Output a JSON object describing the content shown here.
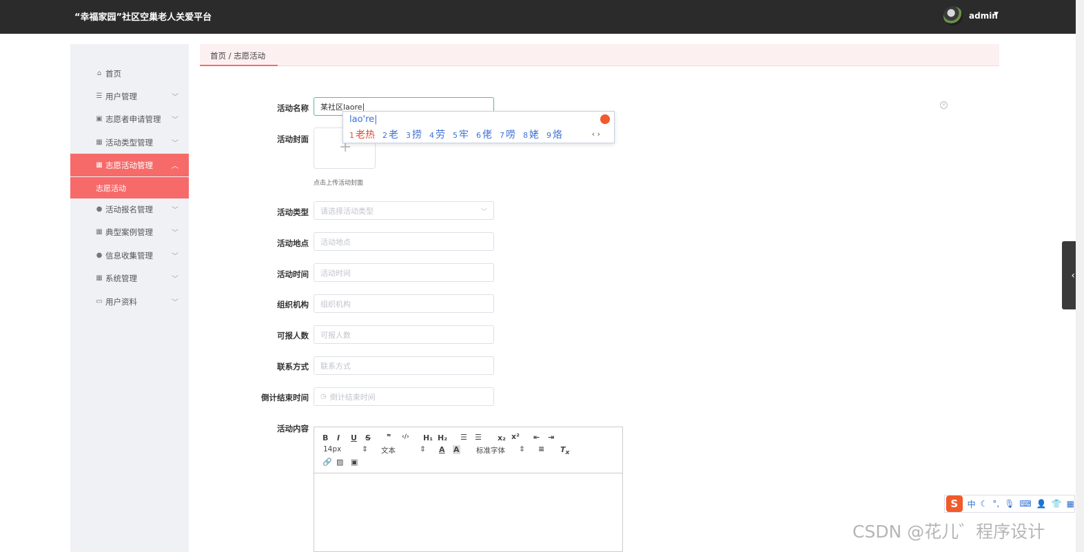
{
  "header": {
    "title": "“幸福家园”社区空巢老人关爱平台",
    "user": "admin"
  },
  "sidebar": {
    "items": [
      {
        "label": "首页",
        "icon": "home-icon",
        "glyph": "⌂",
        "expandable": false
      },
      {
        "label": "用户管理",
        "icon": "menu-icon",
        "glyph": "☰",
        "expandable": true
      },
      {
        "label": "志愿者申请管理",
        "icon": "clipboard-icon",
        "glyph": "▣",
        "expandable": true
      },
      {
        "label": "活动类型管理",
        "icon": "grid-icon",
        "glyph": "▦",
        "expandable": true
      },
      {
        "label": "志愿活动管理",
        "icon": "grid-icon",
        "glyph": "▦",
        "expandable": true,
        "active": true
      },
      {
        "label": "活动报名管理",
        "icon": "user-icon",
        "glyph": "●",
        "expandable": true
      },
      {
        "label": "典型案例管理",
        "icon": "grid-icon",
        "glyph": "▦",
        "expandable": true
      },
      {
        "label": "信息收集管理",
        "icon": "location-icon",
        "glyph": "●",
        "expandable": true
      },
      {
        "label": "系统管理",
        "icon": "grid-icon",
        "glyph": "▦",
        "expandable": true
      },
      {
        "label": "用户资料",
        "icon": "card-icon",
        "glyph": "▭",
        "expandable": true
      }
    ],
    "submenu_active": "志愿活动"
  },
  "breadcrumb": "首页 / 志愿活动",
  "form": {
    "name": {
      "label": "活动名称",
      "value": "某社区laore"
    },
    "cover": {
      "label": "活动封面",
      "hint": "点击上传活动封面"
    },
    "type": {
      "label": "活动类型",
      "placeholder": "请选择活动类型"
    },
    "location": {
      "label": "活动地点",
      "placeholder": "活动地点"
    },
    "time": {
      "label": "活动时间",
      "placeholder": "活动时间"
    },
    "organizer": {
      "label": "组织机构",
      "placeholder": "组织机构"
    },
    "capacity": {
      "label": "可报人数",
      "placeholder": "可报人数"
    },
    "contact": {
      "label": "联系方式",
      "placeholder": "联系方式"
    },
    "countdown": {
      "label": "倒计结束时间",
      "placeholder": "倒计结束时间"
    },
    "content": {
      "label": "活动内容"
    }
  },
  "ime": {
    "pinyin": "lao're",
    "candidates": [
      "老热",
      "老",
      "捞",
      "劳",
      "牢",
      "佬",
      "唠",
      "姥",
      "烙"
    ]
  },
  "editor": {
    "font_size": "14px",
    "text_type": "文本",
    "font_family": "标准字体"
  },
  "ime_bar": {
    "mode": "中"
  },
  "watermark": "CSDN @花儿゛程序设计"
}
